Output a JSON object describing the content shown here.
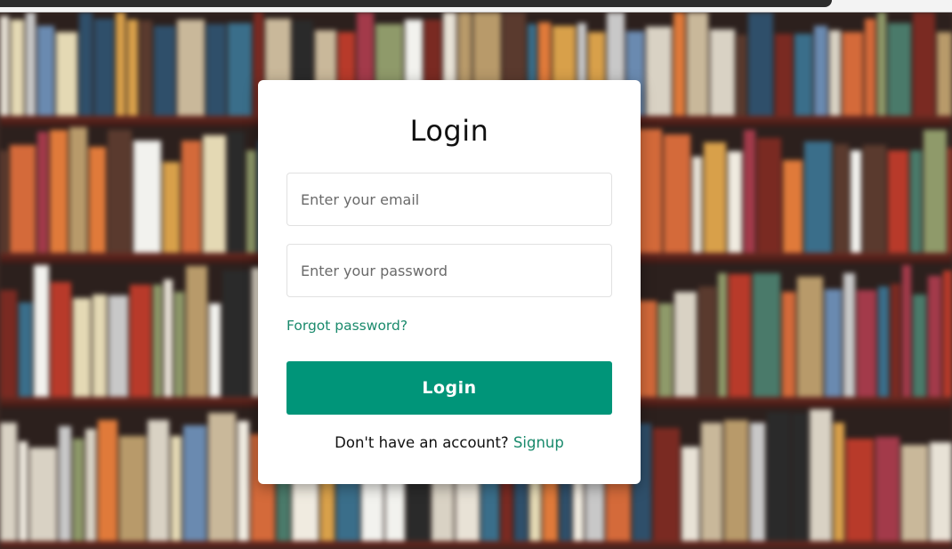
{
  "form": {
    "title": "Login",
    "email_placeholder": "Enter your email",
    "email_value": "",
    "password_placeholder": "Enter your password",
    "password_value": "",
    "forgot_label": "Forgot password?",
    "login_label": "Login",
    "signup_prompt": "Don't have an account?",
    "signup_label": "Signup"
  },
  "colors": {
    "accent": "#009579",
    "link": "#1a8a6c",
    "card_background": "#ffffff"
  }
}
